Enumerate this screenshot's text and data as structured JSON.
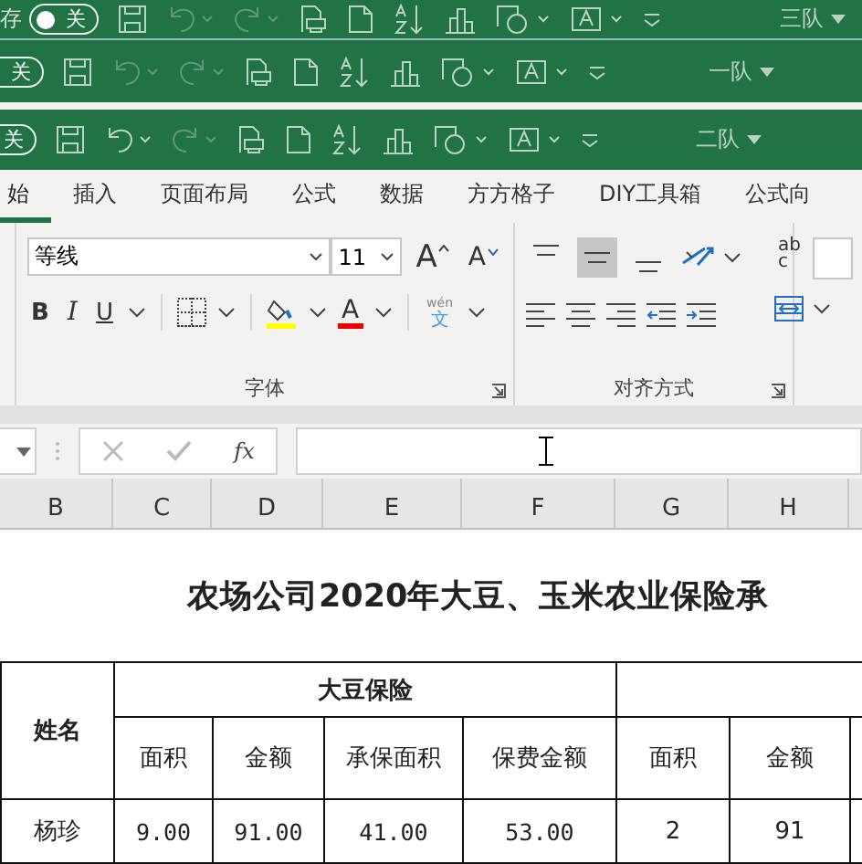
{
  "title_bars": [
    {
      "save_label": "存",
      "autosave": "关",
      "autosave_on": false,
      "undo_enabled": false,
      "account": "三队"
    },
    {
      "autosave": "关",
      "autosave_on": false,
      "undo_enabled": false,
      "account": "一队"
    },
    {
      "autosave": "关",
      "autosave_on": false,
      "undo_enabled": true,
      "account": "二队"
    }
  ],
  "ribbon_tabs": [
    {
      "label": "始",
      "selected": true
    },
    {
      "label": "插入",
      "selected": false
    },
    {
      "label": "页面布局",
      "selected": false
    },
    {
      "label": "公式",
      "selected": false
    },
    {
      "label": "数据",
      "selected": false
    },
    {
      "label": "方方格子",
      "selected": false
    },
    {
      "label": "DIY工具箱",
      "selected": false
    },
    {
      "label": "公式向",
      "selected": false
    }
  ],
  "font_group": {
    "font": "等线",
    "size": "11",
    "grow": "A",
    "shrink": "A",
    "bold": "B",
    "italic": "I",
    "underline": "U",
    "font_color": "A",
    "phonetic_top": "wén",
    "phonetic_bottom": "文",
    "label": "字体"
  },
  "alignment_group": {
    "vertical": [
      {
        "selected": false
      },
      {
        "selected": true
      },
      {
        "selected": false
      }
    ],
    "wrap_top": "ab",
    "wrap_bottom": "c",
    "label": "对齐方式"
  },
  "formula_bar": {
    "fx": "fx"
  },
  "column_headers": [
    "B",
    "C",
    "D",
    "E",
    "F",
    "G",
    "H"
  ],
  "sheet": {
    "title": "农场公司2020年大豆、玉米农业保险承",
    "name_header": "姓名",
    "group_header": "大豆保险",
    "subheaders": [
      "面积",
      "金额",
      "承保面积",
      "保费金额",
      "面积",
      "金额"
    ],
    "rows": [
      [
        "杨珍",
        "9.00",
        "91.00",
        "41.00",
        "53.00",
        "2",
        "91"
      ]
    ]
  }
}
